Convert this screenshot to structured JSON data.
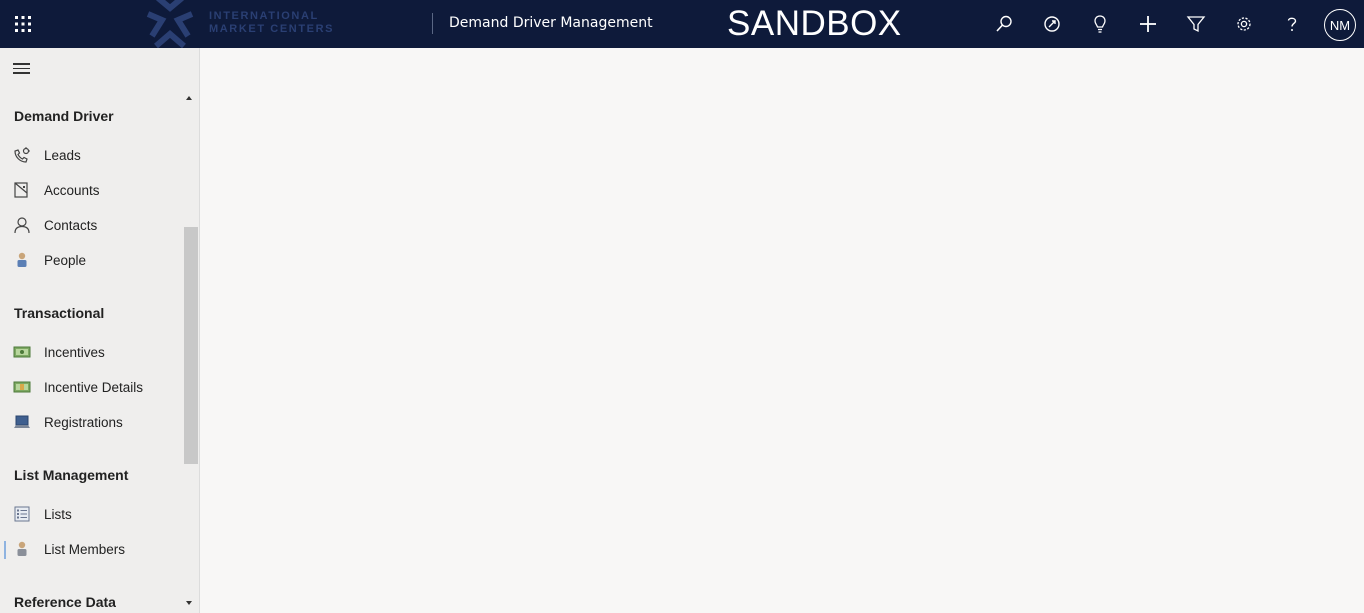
{
  "header": {
    "logo_text_line1": "INTERNATIONAL",
    "logo_text_line2": "MARKET CENTERS",
    "app_title": "Demand Driver Management",
    "environment": "SANDBOX",
    "avatar_initials": "NM",
    "icons": [
      "search-icon",
      "assistant-icon",
      "lightbulb-icon",
      "plus-icon",
      "filter-icon",
      "settings-icon",
      "help-icon"
    ]
  },
  "sidebar": {
    "groups": [
      {
        "title": "Demand Driver",
        "items": [
          {
            "label": "Leads",
            "icon": "phone-lead-icon"
          },
          {
            "label": "Accounts",
            "icon": "account-icon"
          },
          {
            "label": "Contacts",
            "icon": "contact-icon"
          },
          {
            "label": "People",
            "icon": "person-icon"
          }
        ]
      },
      {
        "title": "Transactional",
        "items": [
          {
            "label": "Incentives",
            "icon": "money-icon"
          },
          {
            "label": "Incentive Details",
            "icon": "money-detail-icon"
          },
          {
            "label": "Registrations",
            "icon": "laptop-icon"
          }
        ]
      },
      {
        "title": "List Management",
        "items": [
          {
            "label": "Lists",
            "icon": "list-icon"
          },
          {
            "label": "List Members",
            "icon": "person-icon"
          }
        ]
      },
      {
        "title": "Reference Data",
        "items": []
      }
    ]
  },
  "colors": {
    "topbar": "#0e1a3a",
    "sidebar": "#efeeed",
    "main": "#f8f7f6",
    "selected_indicator": "#8fb3e0"
  }
}
